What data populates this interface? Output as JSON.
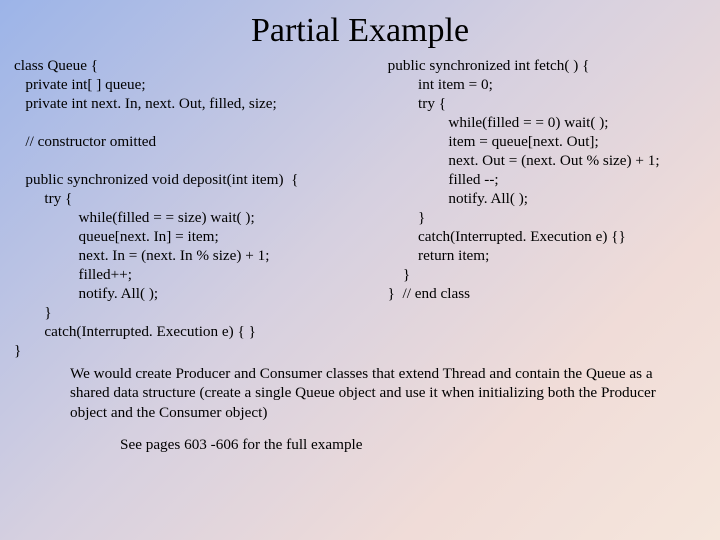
{
  "title": "Partial Example",
  "code_left": "class Queue {\n   private int[ ] queue;\n   private int next. In, next. Out, filled, size;\n\n   // constructor omitted\n\n   public synchronized void deposit(int item)  {\n        try {\n                 while(filled = = size) wait( );\n                 queue[next. In] = item;\n                 next. In = (next. In % size) + 1;\n                 filled++;\n                 notify. All( );\n        }\n        catch(Interrupted. Execution e) { }\n}",
  "code_right": "public synchronized int fetch( ) {\n        int item = 0;\n        try {\n                while(filled = = 0) wait( );\n                item = queue[next. Out];\n                next. Out = (next. Out % size) + 1;\n                filled --;\n                notify. All( );\n        }\n        catch(Interrupted. Execution e) {}\n        return item;\n    }\n}  // end class",
  "footer_text": "We would create Producer and Consumer classes that extend Thread and contain the Queue as a shared data structure (create a single Queue object and use it when initializing both the Producer object and the Consumer object)",
  "see_pages": "See pages 603 -606 for the full example"
}
